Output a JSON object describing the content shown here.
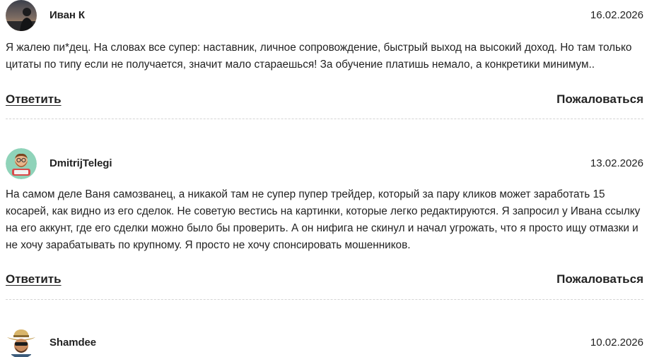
{
  "comments": [
    {
      "author": "Иван К",
      "date": "16.02.2026",
      "avatar_icon": "sunset-silhouette-avatar",
      "text": "Я жалею пи*дец. На словах все супер: наставник, личное сопровождение, быстрый выход на высокий доход. Но там только цитаты по типу если не получается, значит мало стараешься! За обучение платишь немало, а конкретики минимум..",
      "reply_label": "Ответить",
      "report_label": "Пожаловаться"
    },
    {
      "author": "DmitrijTelegi",
      "date": "13.02.2026",
      "avatar_icon": "cartoon-bearded-man-avatar",
      "text": "На самом деле Ваня самозванец, а никакой там не супер пупер трейдер, который за пару кликов может заработать 15 косарей, как видно из его сделок. Не советую вестись на картинки, которые легко редактируются. Я запросил у Ивана ссылку на его аккунт, где его сделки можно было бы проверить. А он нифига не скинул и начал угрожать, что я просто ищу отмазки и не хочу зарабатывать по крупному. Я просто не хочу спонсировать мошенников.",
      "reply_label": "Ответить",
      "report_label": "Пожаловаться"
    },
    {
      "author": "Shamdee",
      "date": "10.02.2026",
      "avatar_icon": "cowboy-hat-man-avatar"
    }
  ]
}
